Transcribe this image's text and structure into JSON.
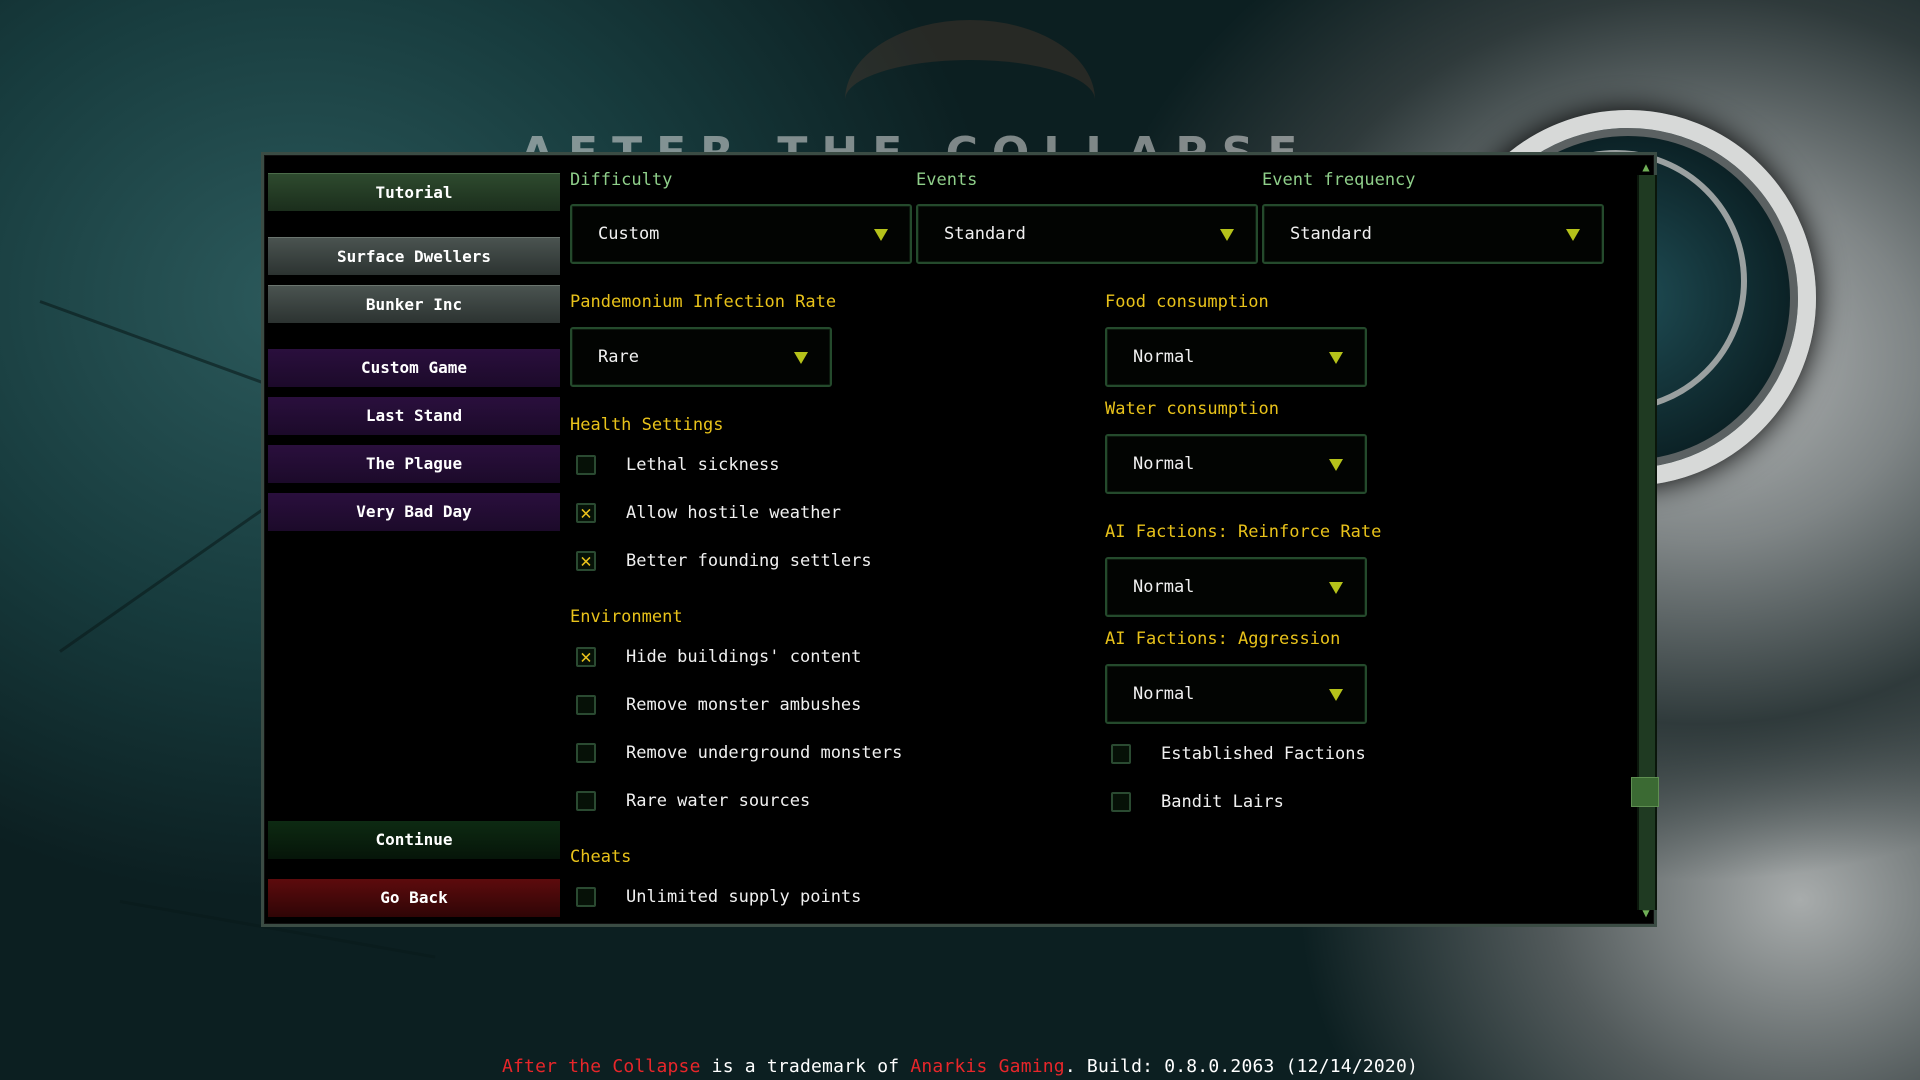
{
  "background": {
    "title_ghost": "AFTER THE COLLAPSE"
  },
  "menu": {
    "tutorial": "Tutorial",
    "surface_dwellers": "Surface Dwellers",
    "bunker_inc": "Bunker Inc",
    "custom_game": "Custom Game",
    "last_stand": "Last Stand",
    "the_plague": "The Plague",
    "very_bad_day": "Very Bad Day",
    "continue": "Continue",
    "go_back": "Go Back"
  },
  "top_settings": {
    "difficulty": {
      "label": "Difficulty",
      "value": "Custom"
    },
    "events": {
      "label": "Events",
      "value": "Standard"
    },
    "event_frequency": {
      "label": "Event frequency",
      "value": "Standard"
    }
  },
  "left_column": {
    "pandemonium": {
      "label": "Pandemonium Infection Rate",
      "value": "Rare"
    },
    "health_settings": {
      "heading": "Health Settings",
      "items": [
        {
          "label": "Lethal sickness",
          "checked": false
        },
        {
          "label": "Allow hostile weather",
          "checked": true
        },
        {
          "label": "Better founding settlers",
          "checked": true
        }
      ]
    },
    "environment": {
      "heading": "Environment",
      "items": [
        {
          "label": "Hide buildings' content",
          "checked": true
        },
        {
          "label": "Remove monster ambushes",
          "checked": false
        },
        {
          "label": "Remove underground monsters",
          "checked": false
        },
        {
          "label": "Rare water sources",
          "checked": false
        }
      ]
    },
    "cheats": {
      "heading": "Cheats",
      "items": [
        {
          "label": "Unlimited supply points",
          "checked": false
        }
      ]
    }
  },
  "right_column": {
    "food_consumption": {
      "label": "Food consumption",
      "value": "Normal"
    },
    "water_consumption": {
      "label": "Water consumption",
      "value": "Normal"
    },
    "reinforce_rate": {
      "label": "AI Factions: Reinforce Rate",
      "value": "Normal"
    },
    "aggression": {
      "label": "AI Factions: Aggression",
      "value": "Normal"
    },
    "established_factions": {
      "label": "Established Factions",
      "checked": false
    },
    "bandit_lairs": {
      "label": "Bandit Lairs",
      "checked": false
    }
  },
  "check_mark": "✕",
  "footer": {
    "game_name": "After the Collapse",
    "mid_text": " is a trademark of ",
    "company": "Anarkis Gaming",
    "build_text": ". Build: 0.8.0.2063 (12/14/2020)"
  },
  "colors": {
    "accent_yellow": "#e8c21a",
    "label_green": "#8fcf8a",
    "trademark_red": "#e8262a"
  }
}
